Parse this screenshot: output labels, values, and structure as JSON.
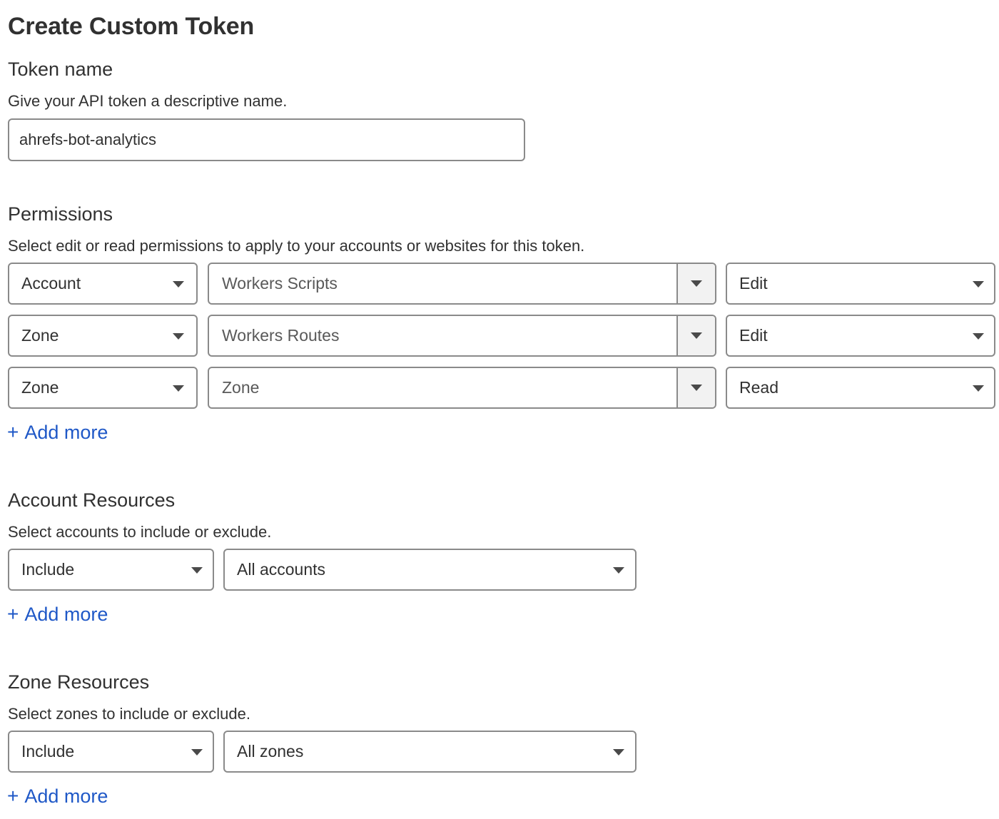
{
  "page": {
    "title": "Create Custom Token"
  },
  "token_name": {
    "heading": "Token name",
    "description": "Give your API token a descriptive name.",
    "value": "ahrefs-bot-analytics"
  },
  "permissions": {
    "heading": "Permissions",
    "description": "Select edit or read permissions to apply to your accounts or websites for this token.",
    "rows": [
      {
        "scope": "Account",
        "permission": "Workers Scripts",
        "access": "Edit"
      },
      {
        "scope": "Zone",
        "permission": "Workers Routes",
        "access": "Edit"
      },
      {
        "scope": "Zone",
        "permission": "Zone",
        "access": "Read"
      }
    ],
    "add_more": "Add more"
  },
  "account_resources": {
    "heading": "Account Resources",
    "description": "Select accounts to include or exclude.",
    "mode": "Include",
    "target": "All accounts",
    "add_more": "Add more"
  },
  "zone_resources": {
    "heading": "Zone Resources",
    "description": "Select zones to include or exclude.",
    "mode": "Include",
    "target": "All zones",
    "add_more": "Add more"
  },
  "icons": {
    "add": "plus-icon",
    "dropdown": "caret-down-icon"
  },
  "colors": {
    "link": "#1f58c7",
    "text": "#313131",
    "border": "#8a8a8a"
  }
}
